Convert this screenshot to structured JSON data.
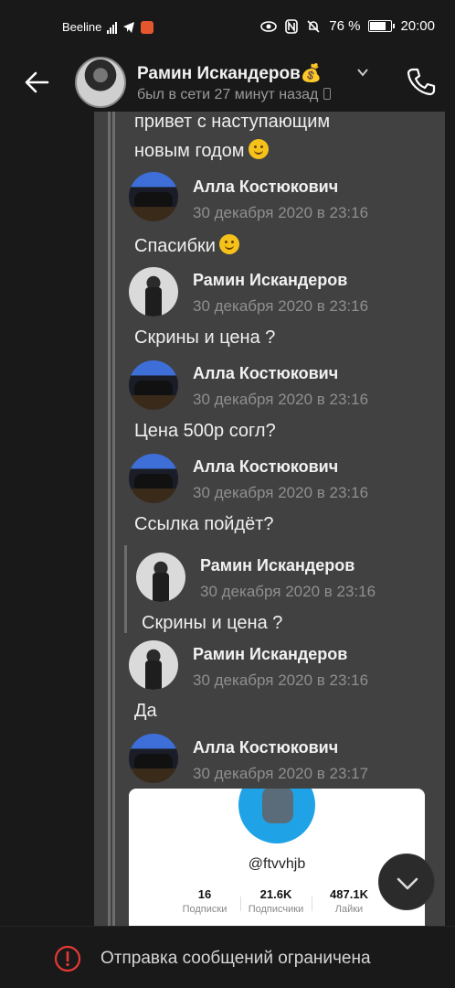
{
  "status_bar": {
    "carrier": "Beeline",
    "network": "4G",
    "battery": "76 %",
    "time": "20:00"
  },
  "header": {
    "name": "Рамин Искандеров💰",
    "last_seen": "был в сети 27 минут назад"
  },
  "messages": {
    "greeting_line1": "привет  с наступающим",
    "greeting_line2": "новым годом",
    "items": [
      {
        "sender": "Алла Костюкович",
        "date": "30 декабря 2020 в 23:16",
        "text": "Спасибки"
      },
      {
        "sender": "Рамин Искандеров",
        "date": "30 декабря 2020 в 23:16",
        "text": "Скрины и цена ?"
      },
      {
        "sender": "Алла Костюкович",
        "date": "30 декабря 2020 в 23:16",
        "text": "Цена 500р согл?"
      },
      {
        "sender": "Алла Костюкович",
        "date": "30 декабря 2020 в 23:16",
        "text": "Ссылка пойдёт?"
      },
      {
        "sender": "Рамин Искандеров",
        "date": "30 декабря 2020 в 23:16",
        "text": "Скрины и цена ?"
      },
      {
        "sender": "Рамин Искандеров",
        "date": "30 декабря 2020 в 23:16",
        "text": "Да"
      },
      {
        "sender": "Алла Костюкович",
        "date": "30 декабря 2020 в 23:17",
        "text": ""
      }
    ]
  },
  "profile_card": {
    "username": "@ftvvhjb",
    "stats": [
      {
        "value": "16",
        "label": "Подписки"
      },
      {
        "value": "21.6K",
        "label": "Подписчики"
      },
      {
        "value": "487.1K",
        "label": "Лайки"
      }
    ]
  },
  "bottom_bar": {
    "text": "Отправка сообщений ограничена"
  },
  "icons": {
    "back": "arrow-left-icon",
    "call": "phone-icon",
    "dropdown": "chevron-down-icon",
    "scroll": "chevron-down-icon",
    "warning": "exclamation-circle-icon"
  },
  "colors": {
    "background": "#191919",
    "bubble": "#414141",
    "warning": "#e53935"
  }
}
